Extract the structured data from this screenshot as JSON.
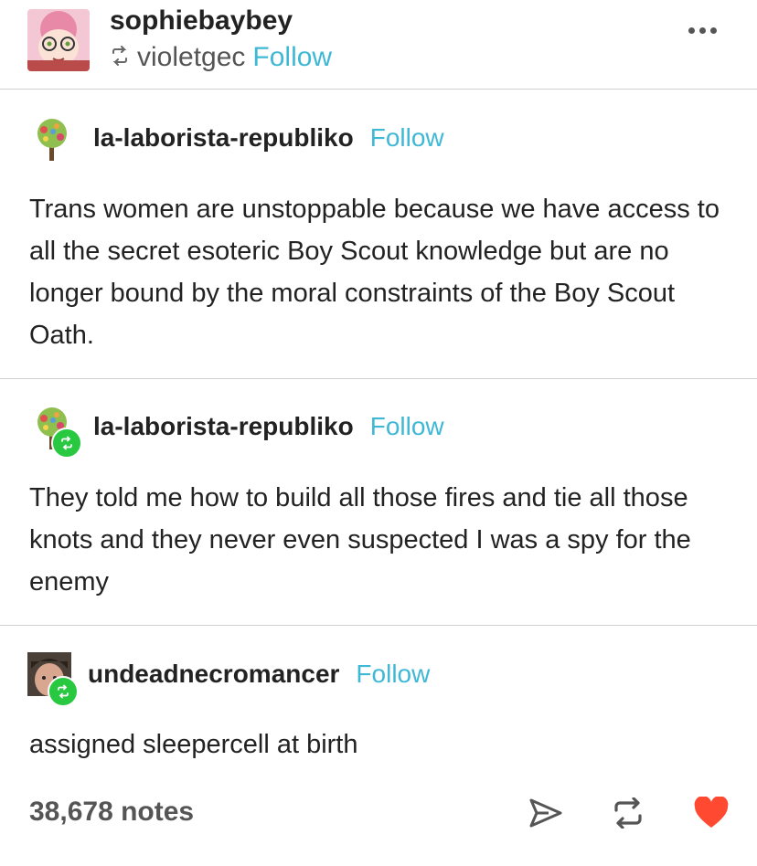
{
  "header": {
    "username": "sophiebaybey",
    "reblogged_from": "violetgec",
    "follow_label": "Follow"
  },
  "posts": [
    {
      "blog": "la-laborista-republiko",
      "follow_label": "Follow",
      "text": "Trans women are unstoppable because we have access to all the secret esoteric Boy Scout knowledge but are no longer bound by the moral constraints of the Boy Scout Oath."
    },
    {
      "blog": "la-laborista-republiko",
      "follow_label": "Follow",
      "text": "They told me how to build all those fires and tie all those knots and they never even suspected I was a spy for the enemy"
    },
    {
      "blog": "undeadnecromancer",
      "follow_label": "Follow",
      "text": "assigned sleepercell at birth"
    }
  ],
  "footer": {
    "notes": "38,678 notes"
  },
  "colors": {
    "follow": "#3fb8d6",
    "reblog_badge": "#28c840",
    "heart": "#ff4930"
  }
}
